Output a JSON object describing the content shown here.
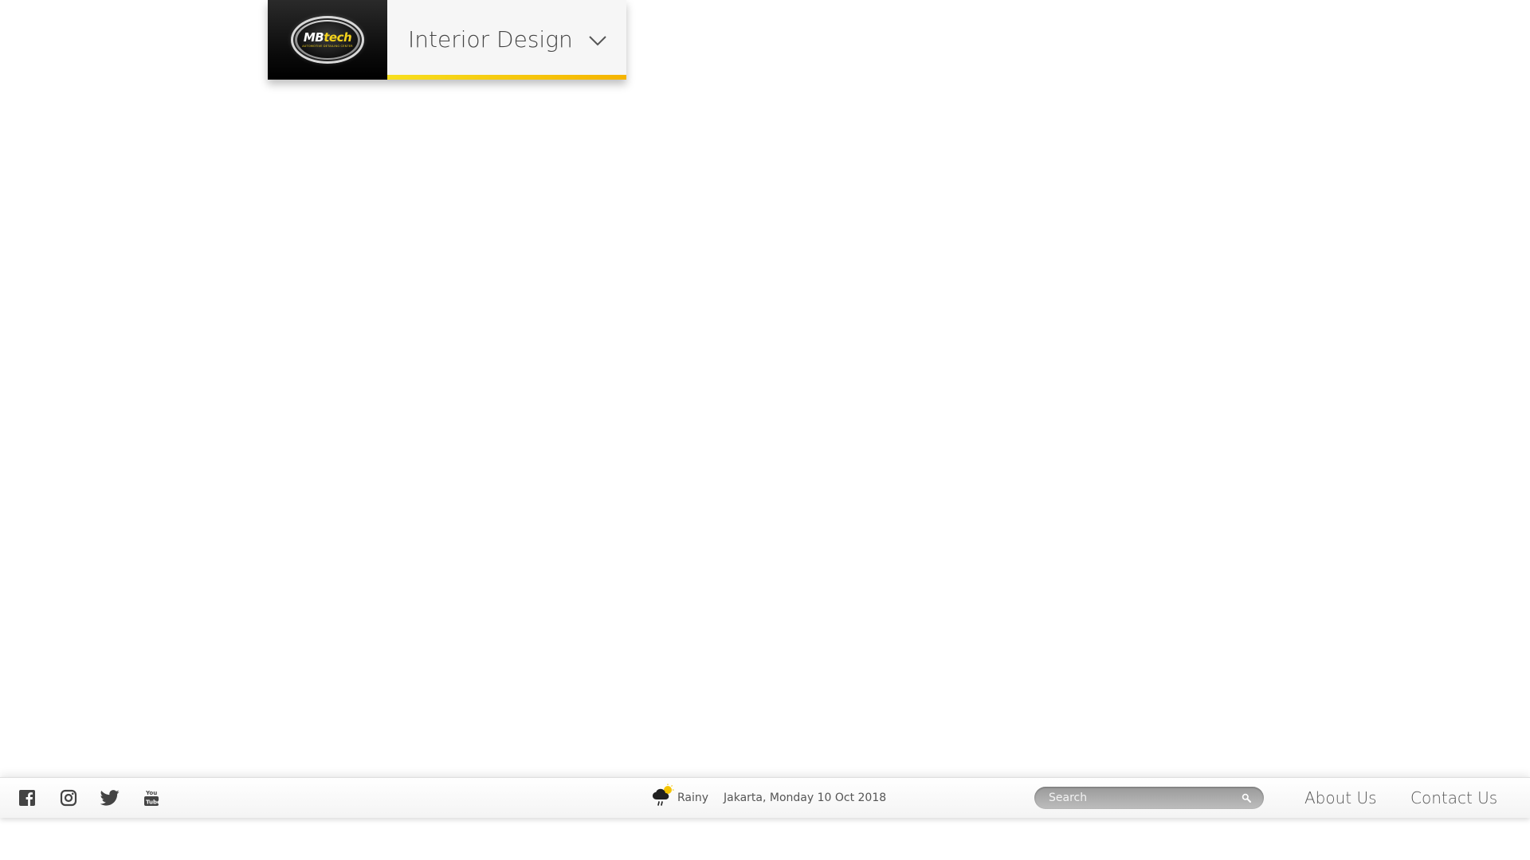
{
  "brand": {
    "logo_text_main": "MB",
    "logo_text_accent": "tech",
    "logo_tagline": "AUTOMOTIVE DETAILING CENTER",
    "category_label": "Interior Design"
  },
  "footer": {
    "social": [
      "facebook-icon",
      "instagram-icon",
      "twitter-icon",
      "youtube-icon"
    ],
    "weather_label": "Rainy",
    "date_text": "Jakarta, Monday 10 Oct 2018",
    "search_placeholder": "Search",
    "nav": {
      "about": "About Us",
      "contact": "Contact Us"
    }
  },
  "colors": {
    "accent_yellow": "#f5c400",
    "footer_text": "#555555",
    "search_bg": "#a8a8a8"
  }
}
